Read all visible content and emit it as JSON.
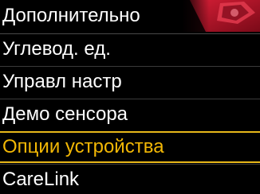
{
  "header": {
    "title": "Дополнительно"
  },
  "menu": {
    "items": [
      {
        "label": "Углевод. ед."
      },
      {
        "label": "Управл настр"
      },
      {
        "label": "Демо сенсора"
      },
      {
        "label": "Опции устройства"
      },
      {
        "label": "CareLink"
      }
    ],
    "selected_index": 3
  },
  "colors": {
    "background": "#000000",
    "text": "#ffffff",
    "highlight": "#f2b705",
    "header_art": "#b3122a"
  }
}
